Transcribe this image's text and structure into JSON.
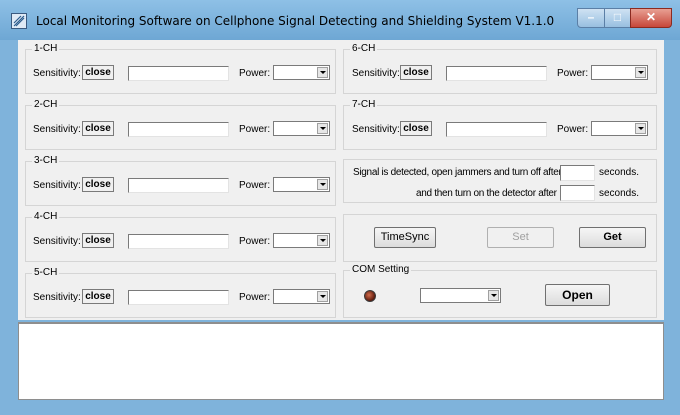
{
  "window": {
    "title": "Local Monitoring Software on Cellphone Signal Detecting and Shielding System V1.1.0"
  },
  "labels": {
    "sensitivity": "Sensitivity:",
    "power": "Power:"
  },
  "channels": [
    {
      "name": "1-CH",
      "sensitivity": "close",
      "power": ""
    },
    {
      "name": "2-CH",
      "sensitivity": "close",
      "power": ""
    },
    {
      "name": "3-CH",
      "sensitivity": "close",
      "power": ""
    },
    {
      "name": "4-CH",
      "sensitivity": "close",
      "power": ""
    },
    {
      "name": "5-CH",
      "sensitivity": "close",
      "power": ""
    },
    {
      "name": "6-CH",
      "sensitivity": "close",
      "power": ""
    },
    {
      "name": "7-CH",
      "sensitivity": "close",
      "power": ""
    }
  ],
  "timing": {
    "line1": "Signal is detected, open jammers and turn off after",
    "line2": "and then turn on the detector after",
    "unit": "seconds.",
    "open_seconds": "",
    "detect_seconds": ""
  },
  "buttons": {
    "timesync": "TimeSync",
    "set": "Set",
    "get": "Get",
    "open": "Open"
  },
  "com": {
    "title": "COM Setting",
    "port": ""
  },
  "log": {
    "text": ""
  }
}
